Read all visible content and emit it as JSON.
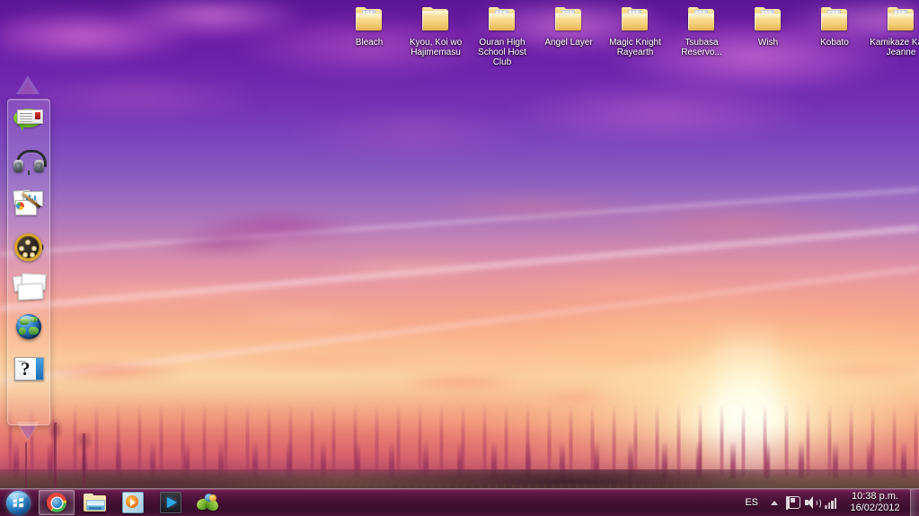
{
  "desktop": {
    "wallpaper_description": "Anime sunset sky, purple to orange gradient with clouds, forest silhouette and sun",
    "accent_colors": {
      "sky_top": "#5b1694",
      "sky_mid": "#b077bc",
      "sky_low": "#fabe92",
      "ground": "#4a2e32",
      "taskbar": "#440e34",
      "folder": "#f3cf76"
    },
    "icons": [
      {
        "name": "Bleach",
        "icon": "folder-icon",
        "style": "open"
      },
      {
        "name": "Kyou, Koi wo Hajimemasu",
        "icon": "folder-icon",
        "style": "closed"
      },
      {
        "name": "Ouran High School Host Club",
        "icon": "folder-icon",
        "style": "open"
      },
      {
        "name": "Angel Layer",
        "icon": "folder-icon",
        "style": "open"
      },
      {
        "name": "Magic Knight Rayearth",
        "icon": "folder-icon",
        "style": "open"
      },
      {
        "name": "Tsubasa Reservo...",
        "icon": "folder-icon",
        "style": "open"
      },
      {
        "name": "Wish",
        "icon": "folder-icon",
        "style": "open"
      },
      {
        "name": "Kobato",
        "icon": "folder-icon",
        "style": "open"
      },
      {
        "name": "Kamikaze Kaito Jeanne",
        "icon": "folder-icon",
        "style": "open"
      }
    ]
  },
  "dock": {
    "scroll_up": "scroll-up-triangle-icon",
    "scroll_down": "scroll-down-triangle-icon",
    "items": [
      {
        "icon": "speech-bubble-note-icon",
        "name": "notes-gadget"
      },
      {
        "icon": "headphones-icon",
        "name": "music-gadget"
      },
      {
        "icon": "documents-pen-icon",
        "name": "documents-gadget"
      },
      {
        "icon": "film-reel-icon",
        "name": "videos-gadget"
      },
      {
        "icon": "photos-stack-icon",
        "name": "pictures-gadget"
      },
      {
        "icon": "globe-icon",
        "name": "internet-gadget"
      },
      {
        "icon": "question-mark-icon",
        "name": "help-gadget"
      }
    ]
  },
  "taskbar": {
    "start_button": "start-orb-icon",
    "pinned": [
      {
        "icon": "chrome-icon",
        "name": "google-chrome",
        "active": true
      },
      {
        "icon": "explorer-folder-icon",
        "name": "windows-explorer",
        "active": false
      },
      {
        "icon": "media-player-icon",
        "name": "windows-media-player",
        "active": false
      },
      {
        "icon": "video-player-play-icon",
        "name": "video-player",
        "active": false
      },
      {
        "icon": "messenger-butterfly-icon",
        "name": "windows-live-messenger",
        "active": false
      }
    ],
    "tray": {
      "language": "ES",
      "chevron": "chevron-up-icon",
      "icons": [
        {
          "icon": "action-center-flag-icon",
          "name": "action-center"
        },
        {
          "icon": "speaker-volume-icon",
          "name": "volume"
        },
        {
          "icon": "network-signal-icon",
          "name": "network"
        }
      ],
      "clock_time": "10:38 p.m.",
      "clock_date": "16/02/2012",
      "show_desktop": "show-desktop-button"
    }
  }
}
